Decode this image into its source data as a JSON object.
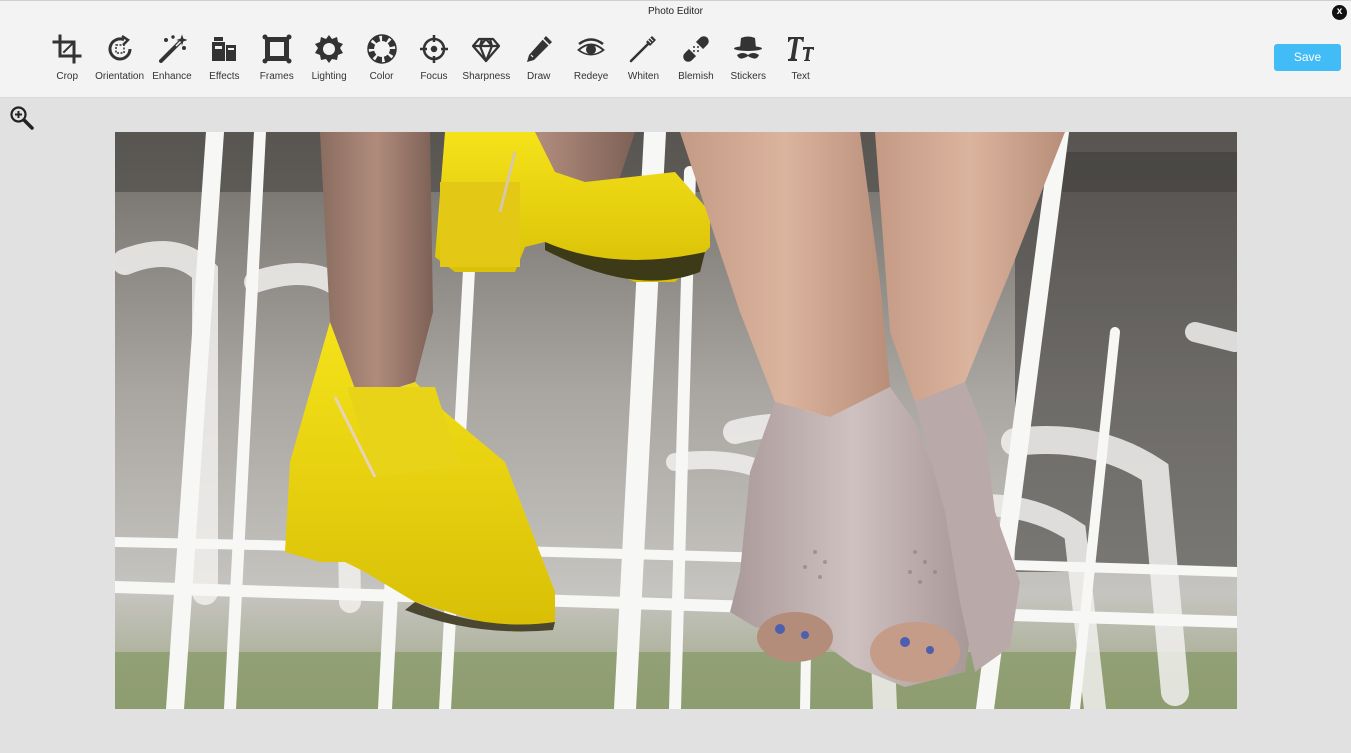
{
  "window": {
    "title": "Photo Editor",
    "close_label": "x"
  },
  "toolbar": {
    "tools": [
      {
        "label": "Crop",
        "icon": "crop-icon"
      },
      {
        "label": "Orientation",
        "icon": "orientation-icon"
      },
      {
        "label": "Enhance",
        "icon": "magic-wand-icon"
      },
      {
        "label": "Effects",
        "icon": "effects-icon"
      },
      {
        "label": "Frames",
        "icon": "frame-icon"
      },
      {
        "label": "Lighting",
        "icon": "sun-icon"
      },
      {
        "label": "Color",
        "icon": "color-wheel-icon"
      },
      {
        "label": "Focus",
        "icon": "crosshair-icon"
      },
      {
        "label": "Sharpness",
        "icon": "diamond-icon"
      },
      {
        "label": "Draw",
        "icon": "pencil-icon"
      },
      {
        "label": "Redeye",
        "icon": "eye-icon"
      },
      {
        "label": "Whiten",
        "icon": "toothbrush-icon"
      },
      {
        "label": "Blemish",
        "icon": "bandage-icon"
      },
      {
        "label": "Stickers",
        "icon": "hat-mustache-icon"
      },
      {
        "label": "Text",
        "icon": "text-icon"
      }
    ],
    "save_label": "Save"
  },
  "canvas": {
    "zoom_icon": "zoom-in-icon"
  },
  "colors": {
    "accent": "#42bcf6",
    "toolbar_bg": "#f3f3f3",
    "canvas_bg": "#e1e1e1",
    "icon": "#333333"
  }
}
